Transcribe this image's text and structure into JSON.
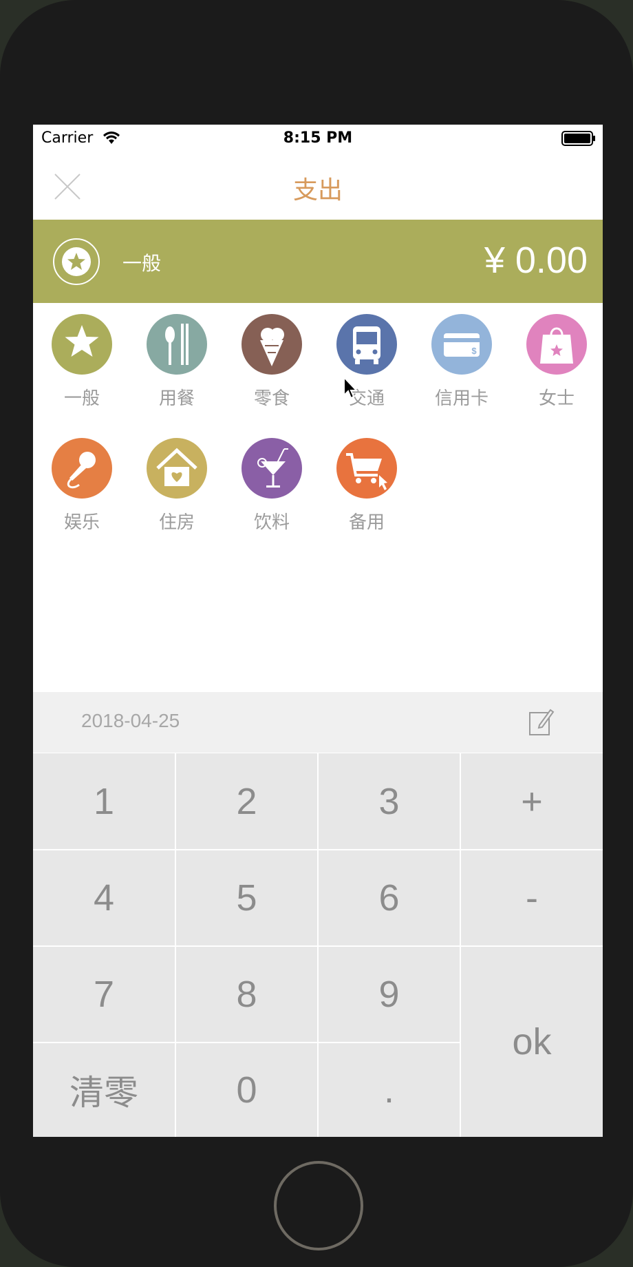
{
  "status": {
    "carrier": "Carrier",
    "time": "8:15 PM"
  },
  "nav": {
    "title": "支出"
  },
  "selected": {
    "name": "一般",
    "amount": "¥ 0.00"
  },
  "categories": [
    {
      "label": "一般",
      "icon": "star-icon",
      "color": "#abad5b"
    },
    {
      "label": "用餐",
      "icon": "utensils-icon",
      "color": "#87a9a2"
    },
    {
      "label": "零食",
      "icon": "ice-cream-icon",
      "color": "#866055"
    },
    {
      "label": "交通",
      "icon": "bus-icon",
      "color": "#5a74ab"
    },
    {
      "label": "信用卡",
      "icon": "credit-card-icon",
      "color": "#93b4da"
    },
    {
      "label": "女士",
      "icon": "shopping-bag-icon",
      "color": "#e083be"
    },
    {
      "label": "娱乐",
      "icon": "microphone-icon",
      "color": "#e57f44"
    },
    {
      "label": "住房",
      "icon": "house-icon",
      "color": "#c8b15f"
    },
    {
      "label": "饮料",
      "icon": "cocktail-icon",
      "color": "#8a5fa6"
    },
    {
      "label": "备用",
      "icon": "shopping-cart-icon",
      "color": "#e8733e"
    }
  ],
  "date": "2018-04-25",
  "keys": {
    "k1": "1",
    "k2": "2",
    "k3": "3",
    "plus": "+",
    "k4": "4",
    "k5": "5",
    "k6": "6",
    "minus": "-",
    "k7": "7",
    "k8": "8",
    "k9": "9",
    "ok": "ok",
    "clear": "清零",
    "k0": "0",
    "dot": "."
  }
}
